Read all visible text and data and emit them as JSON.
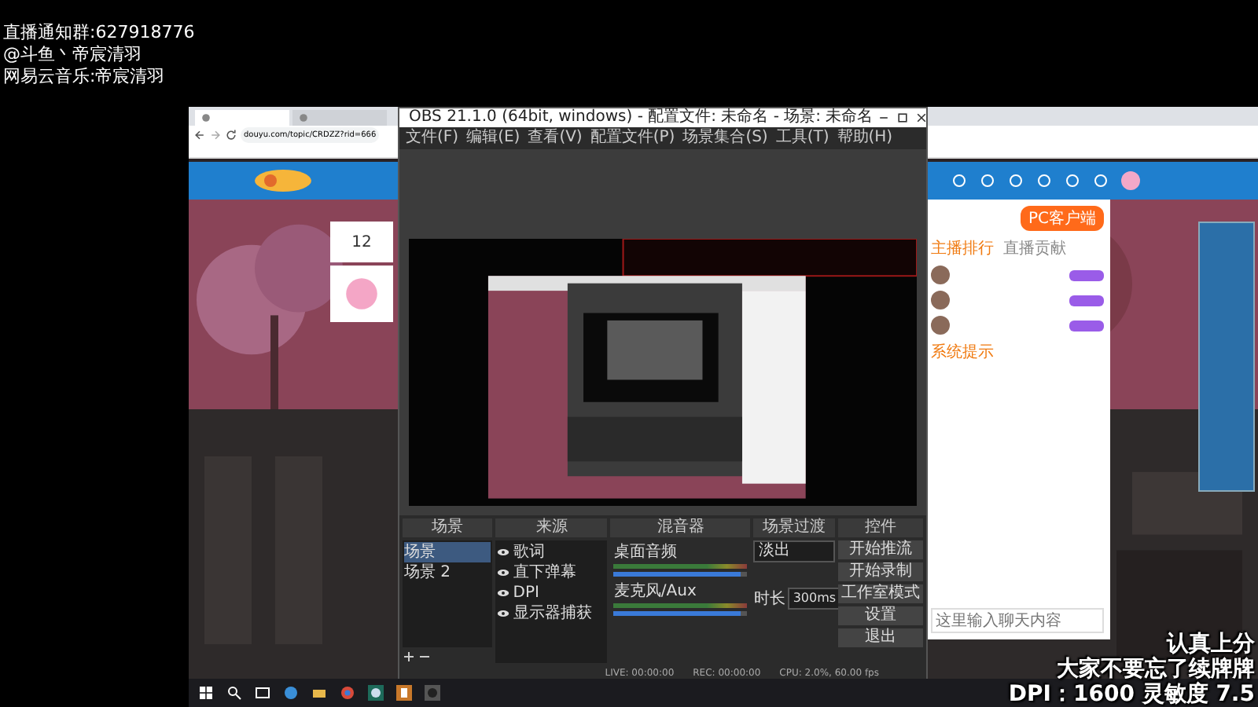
{
  "overlay_top": [
    "直播通知群:627918776",
    "@斗鱼丶帝宸清羽",
    "网易云音乐:帝宸清羽"
  ],
  "browser": {
    "tabs": [
      {
        "selected": true
      },
      {
        "selected": false
      }
    ],
    "url": "douyu.com/topic/CRDZZ?rid=666",
    "score": "12",
    "client_button": "PC客户端",
    "rank_tabs": [
      {
        "label": "主播排行",
        "selected": true
      },
      {
        "label": "直播贡献",
        "selected": false
      }
    ],
    "notice_label": "系统提示",
    "chat_placeholder": "这里输入聊天内容"
  },
  "obs": {
    "title": "OBS 21.1.0 (64bit, windows) - 配置文件: 未命名 - 场景: 未命名",
    "menu": [
      "文件(F)",
      "编辑(E)",
      "查看(V)",
      "配置文件(P)",
      "场景集合(S)",
      "工具(T)",
      "帮助(H)"
    ],
    "docks": {
      "scenes": "场景",
      "sources": "来源",
      "mixer": "混音器",
      "transitions": "场景过渡",
      "controls": "控件"
    },
    "scenes": [
      {
        "name": "场景",
        "selected": true
      },
      {
        "name": "场景 2",
        "selected": false
      }
    ],
    "sources": [
      "歌词",
      "直下弹幕",
      "DPI",
      "显示器捕获"
    ],
    "mixer": [
      {
        "name": "桌面音频",
        "level": 0.95
      },
      {
        "name": "麦克风/Aux",
        "level": 0.95
      }
    ],
    "transition": {
      "type": "淡出",
      "duration_label": "时长",
      "duration": "300ms"
    },
    "controls": [
      "开始推流",
      "开始录制",
      "工作室模式",
      "设置",
      "退出"
    ],
    "status": [
      "LIVE: 00:00:00",
      "REC: 00:00:00",
      "CPU: 2.0%, 60.00 fps"
    ]
  },
  "overlay_bottom": [
    "认真上分",
    "大家不要忘了续牌牌",
    "DPI：1600 灵敏度 7.5"
  ]
}
